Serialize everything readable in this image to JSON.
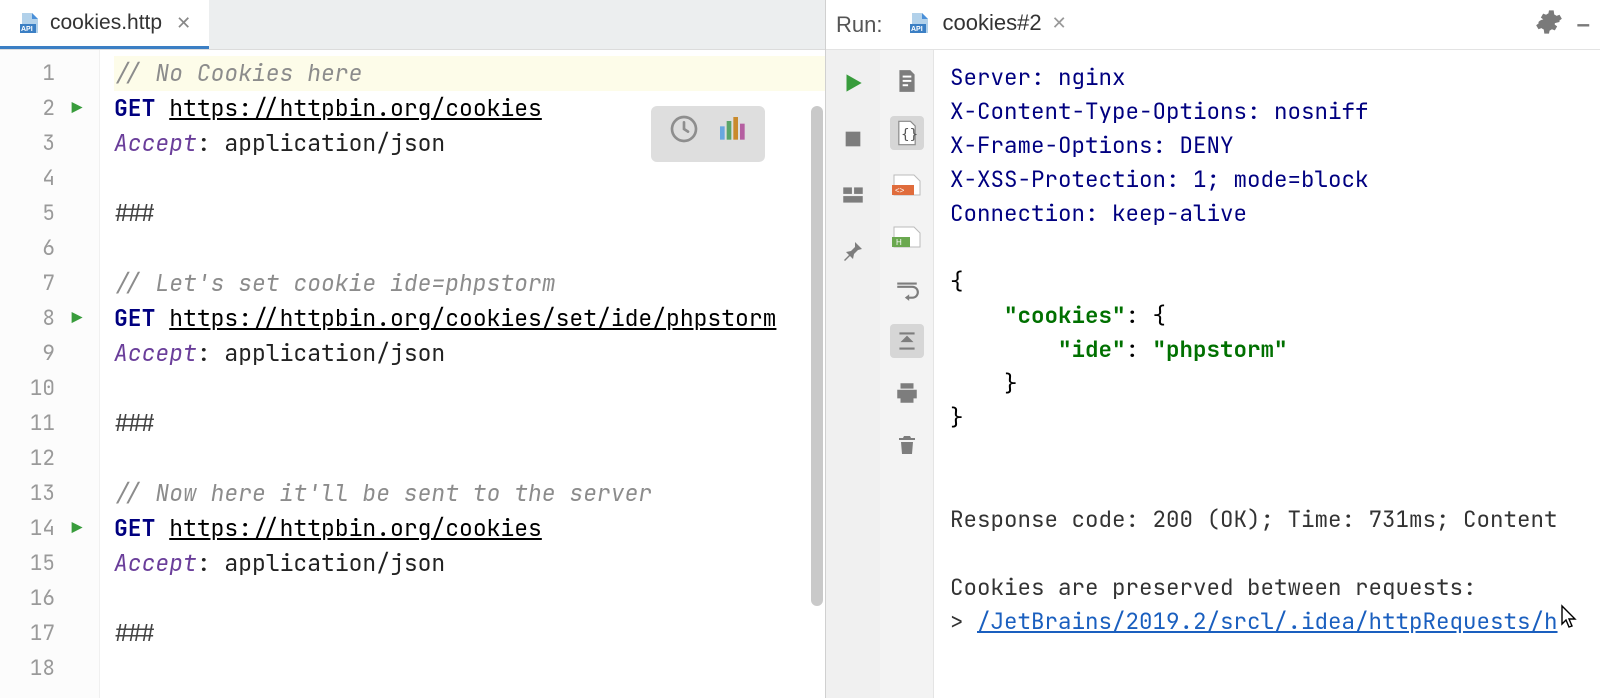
{
  "editor": {
    "tab": {
      "filename": "cookies.http"
    },
    "lines": [
      {
        "n": 1,
        "run": false,
        "type": "comment",
        "text": "// No Cookies here"
      },
      {
        "n": 2,
        "run": true,
        "type": "req",
        "method": "GET",
        "url": "https://httpbin.org/cookies"
      },
      {
        "n": 3,
        "run": false,
        "type": "header",
        "name": "Accept",
        "value": "application/json"
      },
      {
        "n": 4,
        "run": false,
        "type": "blank"
      },
      {
        "n": 5,
        "run": false,
        "type": "sep",
        "text": "###"
      },
      {
        "n": 6,
        "run": false,
        "type": "blank"
      },
      {
        "n": 7,
        "run": false,
        "type": "comment",
        "text": "// Let's set cookie ide=phpstorm"
      },
      {
        "n": 8,
        "run": true,
        "type": "req",
        "method": "GET",
        "url": "https://httpbin.org/cookies/set/ide/phpstorm"
      },
      {
        "n": 9,
        "run": false,
        "type": "header",
        "name": "Accept",
        "value": "application/json"
      },
      {
        "n": 10,
        "run": false,
        "type": "blank"
      },
      {
        "n": 11,
        "run": false,
        "type": "sep",
        "text": "###"
      },
      {
        "n": 12,
        "run": false,
        "type": "blank"
      },
      {
        "n": 13,
        "run": false,
        "type": "comment",
        "text": "// Now here it'll be sent to the server"
      },
      {
        "n": 14,
        "run": true,
        "type": "req",
        "method": "GET",
        "url": "https://httpbin.org/cookies"
      },
      {
        "n": 15,
        "run": false,
        "type": "header",
        "name": "Accept",
        "value": "application/json"
      },
      {
        "n": 16,
        "run": false,
        "type": "blank"
      },
      {
        "n": 17,
        "run": false,
        "type": "sep",
        "text": "###"
      },
      {
        "n": 18,
        "run": false,
        "type": "blank"
      }
    ]
  },
  "run": {
    "title": "Run:",
    "tab": "cookies#2",
    "headers": [
      "Server: nginx",
      "X-Content-Type-Options: nosniff",
      "X-Frame-Options: DENY",
      "X-XSS-Protection: 1; mode=block",
      "Connection: keep-alive"
    ],
    "json": {
      "open": "{",
      "k1": "\"cookies\"",
      "c1": ": {",
      "k2": "\"ide\"",
      "c2": ": ",
      "v2": "\"phpstorm\"",
      "closeInner": "}",
      "closeOuter": "}"
    },
    "status": "Response code: 200 (OK); Time: 731ms; Content",
    "cookieNote": "Cookies are preserved between requests:",
    "caret": "> ",
    "link": "/JetBrains/2019.2/srcl/.idea/httpRequests/h"
  }
}
